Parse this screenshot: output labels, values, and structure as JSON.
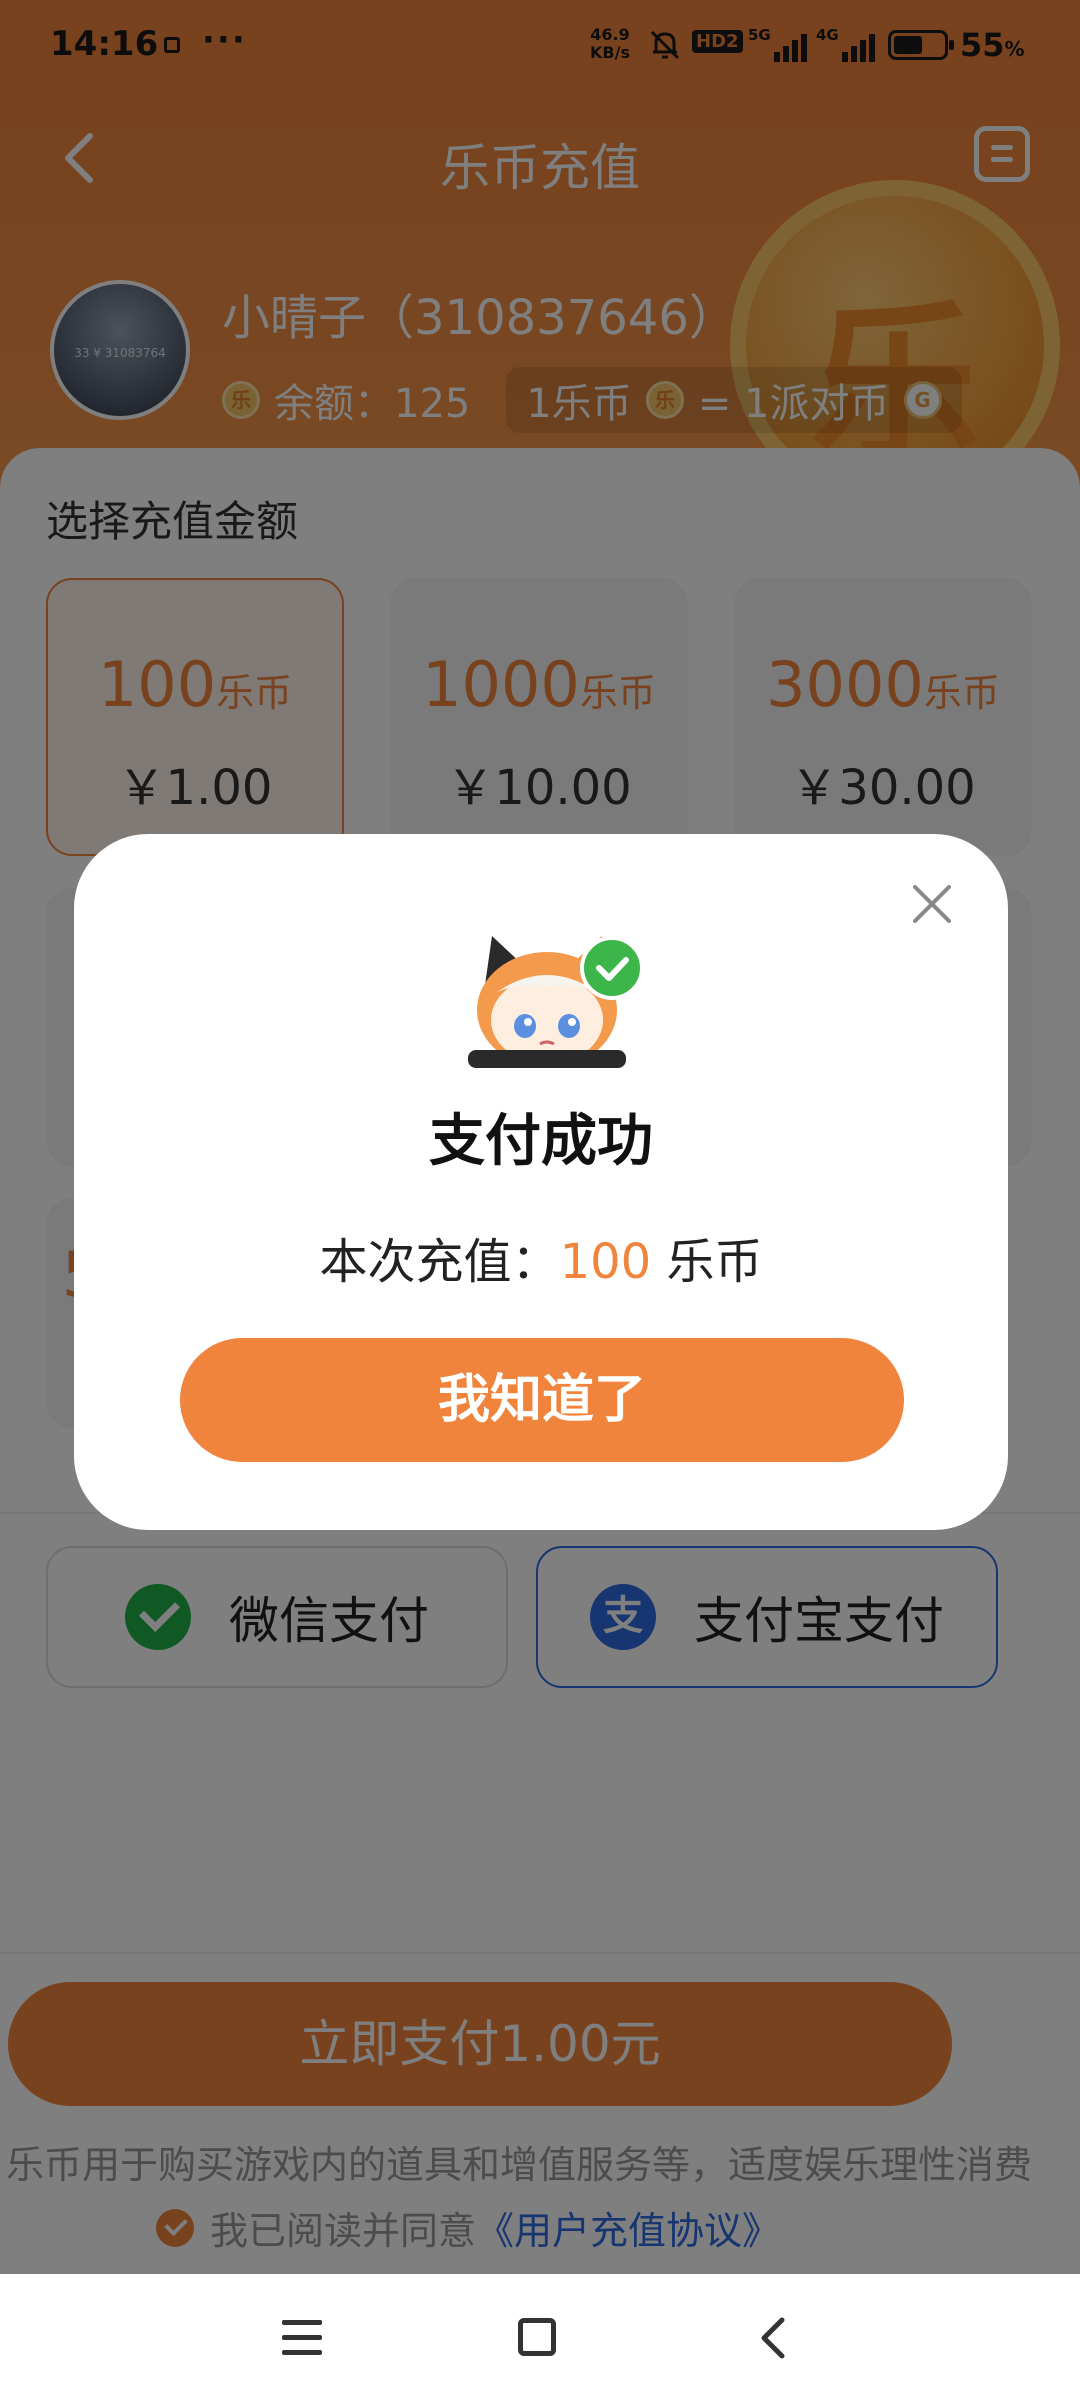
{
  "status_bar": {
    "time": "14:16",
    "net_speed_value": "46.9",
    "net_speed_unit": "KB/s",
    "hd_badge": "HD2",
    "signal_1_label": "5G",
    "signal_2_label": "4G",
    "battery_percent": "55",
    "battery_unit": "%"
  },
  "header": {
    "title": "乐币充值",
    "coin_glyph": "乐",
    "user_name": "小晴子（310837646）",
    "avatar_caption": "33 ¥ 31083764",
    "coin_icon_glyph": "乐",
    "party_icon_glyph": "G",
    "balance_label": "余额：125",
    "rate_left": "1乐币",
    "rate_right": "= 1派对币"
  },
  "recharge": {
    "section_title": "选择充值金额",
    "options": [
      {
        "amount": "100",
        "unit": "乐币",
        "price": "￥1.00",
        "selected": true
      },
      {
        "amount": "1000",
        "unit": "乐币",
        "price": "￥10.00",
        "selected": false
      },
      {
        "amount": "3000",
        "unit": "乐币",
        "price": "￥30.00",
        "selected": false
      }
    ],
    "partial_visible_amount": "5"
  },
  "payment": {
    "wechat_label": "微信支付",
    "alipay_label": "支付宝支付",
    "alipay_glyph": "支",
    "selected_method": "alipay"
  },
  "footer": {
    "pay_button_label": "立即支付1.00元",
    "notice": "乐币用于购买游戏内的道具和增值服务等，适度娱乐理性消费",
    "agree_prefix": "我已阅读并同意",
    "agree_link": "《用户充值协议》"
  },
  "modal": {
    "title": "支付成功",
    "detail_prefix": "本次充值：",
    "detail_amount": "100",
    "detail_unit": " 乐币",
    "confirm_label": "我知道了"
  },
  "colors": {
    "accent": "#f0843d",
    "link": "#2f6be3",
    "wechat": "#21b24a",
    "success": "#3cb54a"
  },
  "icons": [
    "back-icon",
    "record-icon",
    "close-icon",
    "check-icon",
    "wechat-icon",
    "alipay-icon",
    "mute-icon",
    "battery-icon",
    "nav-menu-icon",
    "nav-home-icon",
    "nav-back-icon"
  ]
}
